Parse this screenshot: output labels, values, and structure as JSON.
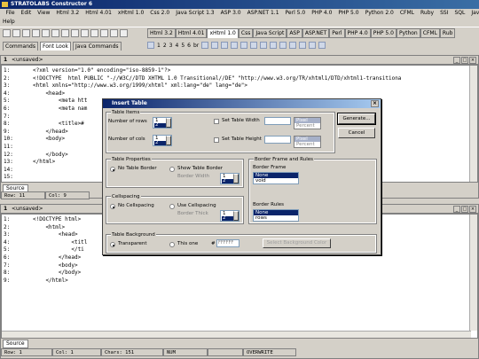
{
  "app": {
    "title": "STRATOLABS Constructor 6"
  },
  "menu": [
    "File",
    "Edit",
    "View",
    "Html 3.2",
    "Html 4.01",
    "xHtml 1.0",
    "Css 2.0",
    "Java Script 1.3",
    "ASP 3.0",
    "ASP.NET 1.1",
    "Perl 5.0",
    "PHP 4.0",
    "PHP 5.0",
    "Python 2.0",
    "CFML",
    "Ruby",
    "SSI",
    "SQL",
    "Java",
    "Extras",
    "Window"
  ],
  "menu2": "Help",
  "left_tabs": [
    "Commands",
    "Font Look",
    "Java Commands"
  ],
  "lang_tabs": [
    "Html 3.2",
    "Html 4.01",
    "xHtml 1.0",
    "Css",
    "Java Script",
    "ASP",
    "ASP.NET",
    "Perl",
    "PHP 4.0",
    "PHP 5.0",
    "Python",
    "CFML",
    "Rub"
  ],
  "tagbar": [
    "1",
    "2",
    "3",
    "4",
    "5",
    "6",
    "br"
  ],
  "doc1": {
    "num": "1",
    "title": "<unsaved>",
    "lines": [
      "1:",
      "2:",
      "3:",
      "4:",
      "5:",
      "6:",
      "7:",
      "8:",
      "9:",
      "10:",
      "11:",
      "12:",
      "13:",
      "14:",
      "15:"
    ],
    "code": [
      "<?xml version=\"1.0\" encoding=\"iso-8859-1\"?>",
      "<!DOCTYPE  html PUBLIC \"-//W3C//DTD XHTML 1.0 Transitional//DE\" \"http://www.w3.org/TR/xhtml1/DTD/xhtml1-transitiona",
      "<html xmlns=\"http://www.w3.org/1999/xhtml\" xml:lang=\"de\" lang=\"de\">",
      "    <head>",
      "        <meta htt",
      "        <meta nam",
      "",
      "        <title>#",
      "    </head>",
      "    <body>",
      "",
      "    </body>",
      "</html>",
      "",
      ""
    ],
    "source_tab": "Source",
    "status": [
      "Row:  11",
      "Col:  9"
    ]
  },
  "doc2": {
    "num": "1",
    "title": "<unsaved>",
    "lines": [
      "1:",
      "2:",
      "3:",
      "4:",
      "5:",
      "6:",
      "7:",
      "8:",
      "9:"
    ],
    "code": [
      "<!DOCTYPE html>",
      "    <html>",
      "        <head>",
      "            <titl",
      "            </ti",
      "        </head>",
      "        <body>",
      "        </body>",
      "    </html>"
    ],
    "source_tab": "Source",
    "status": [
      "Row:  1",
      "Col:  1",
      "Chars:  151",
      "NUM",
      "",
      "OVERWRITE"
    ]
  },
  "dialog": {
    "title": "Insert Table",
    "table_items": "Table Items",
    "rows_label": "Number of rows",
    "rows_value": "1",
    "rows_sel": "2",
    "cols_label": "Number of cols",
    "cols_value": "1",
    "cols_sel": "2",
    "set_width": "Set Table Width",
    "set_height": "Set Table Height",
    "units": [
      "Pixel",
      "Percent"
    ],
    "generate": "Generate...",
    "cancel": "Cancel",
    "table_props": "Table Properties",
    "no_border": "No Table Border",
    "show_border": "Show Table Border",
    "border_width": "Border Width",
    "bw_value": "1",
    "bw_sel": "2",
    "cellspacing": "Cellspacing",
    "no_cellspacing": "No Cellspacing",
    "use_cellspacing": "Use Cellspacing",
    "border_thick": "Border Thick",
    "bt_value": "1",
    "bt_sel": "2",
    "border_frame_rules": "Border Frame and Rules",
    "border_frame": "Border Frame",
    "frame_opts": [
      "None",
      "void"
    ],
    "border_rules": "Border Rules",
    "rules_opts": [
      "None",
      "rows"
    ],
    "table_bg": "Table Background",
    "transparent": "Transparent",
    "this_one": "This one",
    "hash": "#",
    "color_value": "FFFFFF",
    "select_bg": "Select Background Color"
  }
}
